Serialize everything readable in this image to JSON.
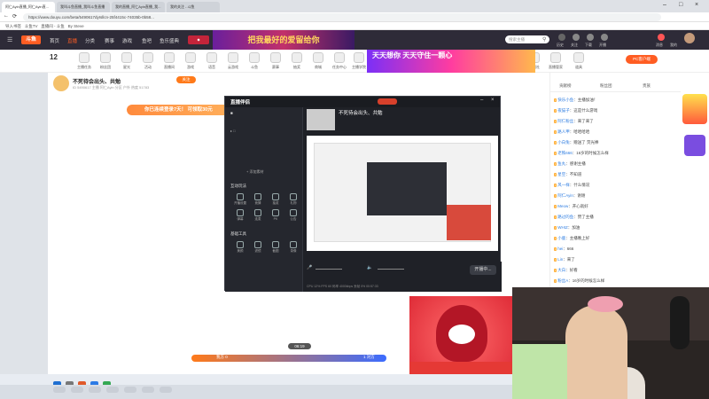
{
  "browser": {
    "tabs": [
      "阿仁Ayin直播_阿仁Ayin直...",
      "我叫斗鱼直播_我叫斗鱼直播",
      "我的直播_阿仁Ayin直播_我...",
      "我的关注 - 斗鱼"
    ],
    "url": "https://www.douyu.com/beta/5490617dyIsllcn-25f4415c-74035b-0b58...",
    "bookmarks": [
      "导入书签",
      "斗鱼TV",
      "直播间 - 斗鱼",
      "By Steve"
    ]
  },
  "site": {
    "logo": "斗鱼",
    "nav": [
      "首页",
      "直播",
      "分类",
      "赛事",
      "游戏",
      "鱼吧",
      "鱼乐盛典"
    ],
    "banner": "把我最好的爱留给你",
    "overlay_banner": "天天想你 天天守住一颗心",
    "search_placeholder": "搜索主播",
    "header_icons": [
      "历史",
      "关注",
      "下载",
      "开播",
      "消息",
      "我的"
    ],
    "pc_button": "PC客户端",
    "categories": [
      "主播任务",
      "粉丝团",
      "星光",
      "活动",
      "直播间",
      "游戏",
      "语音",
      "云游戏",
      "斗鱼",
      "赛事",
      "抽奖",
      "商城",
      "任务中心",
      "主播学院",
      "粉丝俱乐部",
      "福利社",
      "直播管家",
      "道具"
    ]
  },
  "room": {
    "title": "不死待会出头、共勉",
    "follow_label": "关注",
    "meta": "ID 5490617   主播 阿仁Ayin   分区 户外   热度 51783",
    "level_badge": "12"
  },
  "player": {
    "promo": "你已连续登录7天！ 可领取30元",
    "pk_left": "我方 0",
    "pk_right": "1 对方",
    "timer": "06:19"
  },
  "obs": {
    "title": "直播伴侣",
    "stream_title": "不死待会出头、共勉",
    "start_button": "开播中...",
    "section_interactive": "互动玩法",
    "section_tools": "基础工具",
    "add_source": "+ 添加素材",
    "tools_a": [
      "开播设置",
      "竞猜",
      "抽奖",
      "礼物"
    ],
    "tools_b": [
      "弹幕",
      "连麦",
      "PK",
      "公告"
    ],
    "tools_c": [
      "美颜",
      "滤镜",
      "截图",
      "录像"
    ],
    "status": "CPU 12%   FPS 60   码率 4000kbps   丢帧 0%   00:57:33"
  },
  "chat": {
    "tabs": [
      "贡献榜",
      "粉丝团",
      "贵族"
    ],
    "lines": [
      {
        "name": "快乐小鱼",
        "text": "主播加油！"
      },
      {
        "name": "夜猫子",
        "text": "这是什么游戏"
      },
      {
        "name": "阿仁粉丝",
        "text": "来了来了"
      },
      {
        "name": "路人甲",
        "text": "哈哈哈哈"
      },
      {
        "name": "小白兔",
        "text": "赠送了 荧光棒"
      },
      {
        "name": "老铁666",
        "text": "16岁的时候怎么样"
      },
      {
        "name": "鱼丸",
        "text": "感谢主播"
      },
      {
        "name": "星空",
        "text": "不知道"
      },
      {
        "name": "风一样",
        "text": "什么情况"
      },
      {
        "name": "阿仁Ayin",
        "text": "谢谢"
      },
      {
        "name": "Meow",
        "text": "开心就好"
      },
      {
        "name": "路过的鱼",
        "text": "赞了主播"
      },
      {
        "name": "WHIZ",
        "text": "加油"
      },
      {
        "name": "小鹿",
        "text": "主播晚上好"
      },
      {
        "name": "hei",
        "text": "666"
      },
      {
        "name": "Lin",
        "text": "来了"
      },
      {
        "name": "大白",
        "text": "好看"
      },
      {
        "name": "粉丝A",
        "text": "16岁的时候怎么样"
      }
    ]
  }
}
